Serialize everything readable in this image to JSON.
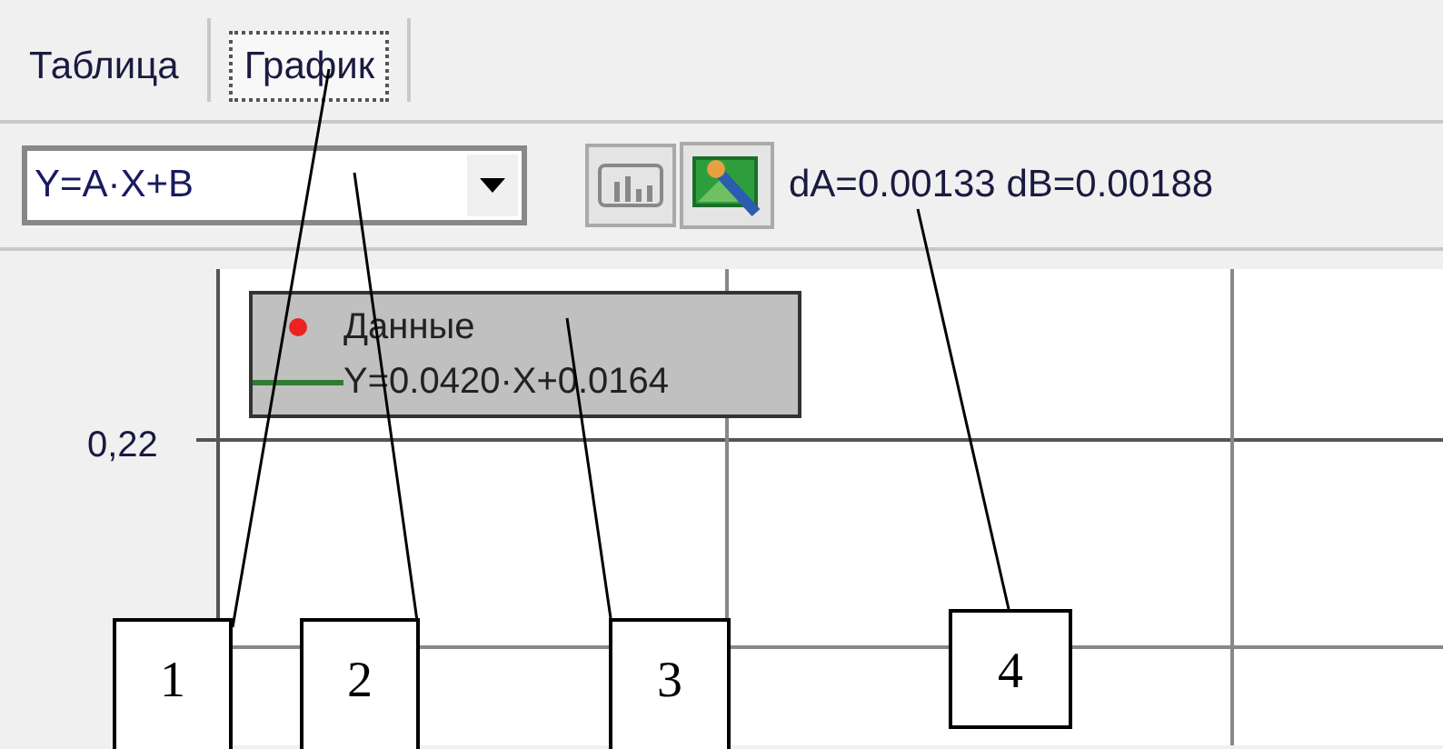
{
  "tabs": [
    {
      "label": "Таблица",
      "selected": false
    },
    {
      "label": "График",
      "selected": true
    }
  ],
  "fit_dropdown": {
    "value": "Y=A·X+B"
  },
  "errors_text": "dA=0.00133 dB=0.00188",
  "plot": {
    "y_tick_label": "0,22",
    "legend": [
      {
        "kind": "points",
        "label": "Данные",
        "color": "#ee2222"
      },
      {
        "kind": "line",
        "label": "Y=0.0420·X+0.0164",
        "color": "#2e7d32"
      }
    ]
  },
  "callouts": [
    "1",
    "2",
    "3",
    "4"
  ]
}
